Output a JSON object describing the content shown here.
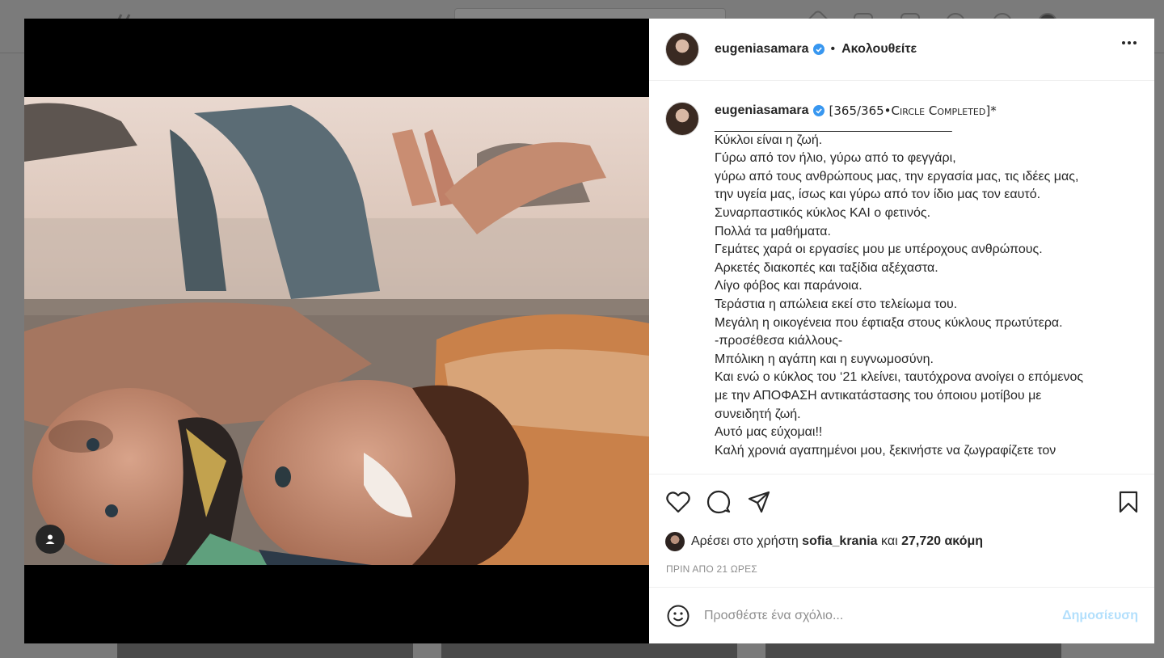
{
  "post": {
    "username": "eugeniasamara",
    "follow_status": "Ακολουθείτε",
    "dot": "•",
    "caption_title": "[365/365•Circle Completed]*",
    "caption_lines": [
      "_________________________________",
      "Κύκλοι είναι η ζωή.",
      "Γύρω από τον ήλιο, γύρω από το φεγγάρι,",
      "γύρω από τους ανθρώπους μας, την εργασία μας, τις ιδέες μας,",
      "την υγεία μας, ίσως και γύρω από τον ίδιο μας τον εαυτό.",
      "Συναρπαστικός κύκλος ΚΑΙ ο φετινός.",
      "Πολλά τα μαθήματα.",
      "Γεμάτες χαρά οι εργασίες μου με υπέροχους ανθρώπους.",
      "Αρκετές διακοπές και ταξίδια αξέχαστα.",
      "Λίγο φόβος και παράνοια.",
      "Τεράστια η απώλεια εκεί στο τελείωμα του.",
      "Μεγάλη η οικογένεια που έφτιαξα στους κύκλους πρωτύτερα.",
      "-προσέθεσα κιάλλους-",
      "Μπόλικη η αγάπη και η ευγνωμοσύνη.",
      "Και ενώ ο κύκλος του ‘21 κλείνει, ταυτόχρονα ανοίγει ο επόμενος",
      "με την ΑΠΟΦΑΣΗ αντικατάστασης του όποιου μοτίβου με",
      "συνειδητή ζωή.",
      "Αυτό μας εύχομαι!!",
      "Καλή χρονιά αγαπημένοι μου, ξεκινήστε να ζωγραφίζετε τον"
    ],
    "likes": {
      "prefix": "Αρέσει στο χρήστη",
      "user": "sofia_krania",
      "joiner": "και",
      "count": "27,720 ακόμη"
    },
    "time_ago": "ΠΡΙΝ ΑΠΟ 21 ΩΡΕΣ",
    "comment_placeholder": "Προσθέστε ένα σχόλιο...",
    "post_button": "Δημοσίευση"
  },
  "icons": {
    "verified": "verified-badge-icon",
    "like": "heart-icon",
    "comment": "comment-bubble-icon",
    "share": "paper-plane-icon",
    "save": "bookmark-icon",
    "emoji": "smiley-icon",
    "more": "more-options-icon",
    "tag": "user-tag-icon"
  },
  "colors": {
    "verified": "#3897f0",
    "post_button_disabled": "#b2dffc",
    "muted_text": "#8e8e8e"
  }
}
